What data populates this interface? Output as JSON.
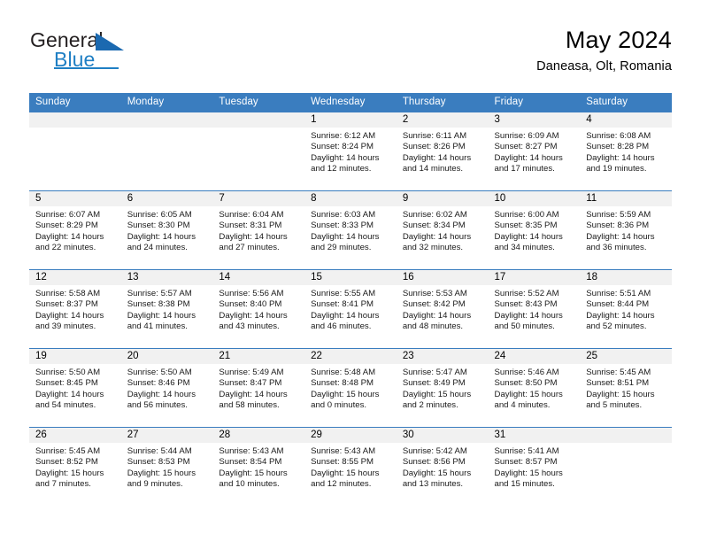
{
  "brand": {
    "name_part1": "General",
    "name_part2": "Blue",
    "logo_icon": "triangle-logo"
  },
  "header": {
    "title": "May 2024",
    "location": "Daneasa, Olt, Romania"
  },
  "colors": {
    "header_blue": "#3a7dbf",
    "brand_blue": "#1f7fc4",
    "daynum_band": "#f1f1f1",
    "text": "#000000"
  },
  "calendar": {
    "weekday_headers": [
      "Sunday",
      "Monday",
      "Tuesday",
      "Wednesday",
      "Thursday",
      "Friday",
      "Saturday"
    ],
    "labels": {
      "sunrise": "Sunrise:",
      "sunset": "Sunset:",
      "daylight": "Daylight:"
    },
    "weeks": [
      [
        {
          "day": "",
          "empty": true
        },
        {
          "day": "",
          "empty": true
        },
        {
          "day": "",
          "empty": true
        },
        {
          "day": "1",
          "sunrise": "Sunrise: 6:12 AM",
          "sunset": "Sunset: 8:24 PM",
          "daylight1": "Daylight: 14 hours",
          "daylight2": "and 12 minutes."
        },
        {
          "day": "2",
          "sunrise": "Sunrise: 6:11 AM",
          "sunset": "Sunset: 8:26 PM",
          "daylight1": "Daylight: 14 hours",
          "daylight2": "and 14 minutes."
        },
        {
          "day": "3",
          "sunrise": "Sunrise: 6:09 AM",
          "sunset": "Sunset: 8:27 PM",
          "daylight1": "Daylight: 14 hours",
          "daylight2": "and 17 minutes."
        },
        {
          "day": "4",
          "sunrise": "Sunrise: 6:08 AM",
          "sunset": "Sunset: 8:28 PM",
          "daylight1": "Daylight: 14 hours",
          "daylight2": "and 19 minutes."
        }
      ],
      [
        {
          "day": "5",
          "sunrise": "Sunrise: 6:07 AM",
          "sunset": "Sunset: 8:29 PM",
          "daylight1": "Daylight: 14 hours",
          "daylight2": "and 22 minutes."
        },
        {
          "day": "6",
          "sunrise": "Sunrise: 6:05 AM",
          "sunset": "Sunset: 8:30 PM",
          "daylight1": "Daylight: 14 hours",
          "daylight2": "and 24 minutes."
        },
        {
          "day": "7",
          "sunrise": "Sunrise: 6:04 AM",
          "sunset": "Sunset: 8:31 PM",
          "daylight1": "Daylight: 14 hours",
          "daylight2": "and 27 minutes."
        },
        {
          "day": "8",
          "sunrise": "Sunrise: 6:03 AM",
          "sunset": "Sunset: 8:33 PM",
          "daylight1": "Daylight: 14 hours",
          "daylight2": "and 29 minutes."
        },
        {
          "day": "9",
          "sunrise": "Sunrise: 6:02 AM",
          "sunset": "Sunset: 8:34 PM",
          "daylight1": "Daylight: 14 hours",
          "daylight2": "and 32 minutes."
        },
        {
          "day": "10",
          "sunrise": "Sunrise: 6:00 AM",
          "sunset": "Sunset: 8:35 PM",
          "daylight1": "Daylight: 14 hours",
          "daylight2": "and 34 minutes."
        },
        {
          "day": "11",
          "sunrise": "Sunrise: 5:59 AM",
          "sunset": "Sunset: 8:36 PM",
          "daylight1": "Daylight: 14 hours",
          "daylight2": "and 36 minutes."
        }
      ],
      [
        {
          "day": "12",
          "sunrise": "Sunrise: 5:58 AM",
          "sunset": "Sunset: 8:37 PM",
          "daylight1": "Daylight: 14 hours",
          "daylight2": "and 39 minutes."
        },
        {
          "day": "13",
          "sunrise": "Sunrise: 5:57 AM",
          "sunset": "Sunset: 8:38 PM",
          "daylight1": "Daylight: 14 hours",
          "daylight2": "and 41 minutes."
        },
        {
          "day": "14",
          "sunrise": "Sunrise: 5:56 AM",
          "sunset": "Sunset: 8:40 PM",
          "daylight1": "Daylight: 14 hours",
          "daylight2": "and 43 minutes."
        },
        {
          "day": "15",
          "sunrise": "Sunrise: 5:55 AM",
          "sunset": "Sunset: 8:41 PM",
          "daylight1": "Daylight: 14 hours",
          "daylight2": "and 46 minutes."
        },
        {
          "day": "16",
          "sunrise": "Sunrise: 5:53 AM",
          "sunset": "Sunset: 8:42 PM",
          "daylight1": "Daylight: 14 hours",
          "daylight2": "and 48 minutes."
        },
        {
          "day": "17",
          "sunrise": "Sunrise: 5:52 AM",
          "sunset": "Sunset: 8:43 PM",
          "daylight1": "Daylight: 14 hours",
          "daylight2": "and 50 minutes."
        },
        {
          "day": "18",
          "sunrise": "Sunrise: 5:51 AM",
          "sunset": "Sunset: 8:44 PM",
          "daylight1": "Daylight: 14 hours",
          "daylight2": "and 52 minutes."
        }
      ],
      [
        {
          "day": "19",
          "sunrise": "Sunrise: 5:50 AM",
          "sunset": "Sunset: 8:45 PM",
          "daylight1": "Daylight: 14 hours",
          "daylight2": "and 54 minutes."
        },
        {
          "day": "20",
          "sunrise": "Sunrise: 5:50 AM",
          "sunset": "Sunset: 8:46 PM",
          "daylight1": "Daylight: 14 hours",
          "daylight2": "and 56 minutes."
        },
        {
          "day": "21",
          "sunrise": "Sunrise: 5:49 AM",
          "sunset": "Sunset: 8:47 PM",
          "daylight1": "Daylight: 14 hours",
          "daylight2": "and 58 minutes."
        },
        {
          "day": "22",
          "sunrise": "Sunrise: 5:48 AM",
          "sunset": "Sunset: 8:48 PM",
          "daylight1": "Daylight: 15 hours",
          "daylight2": "and 0 minutes."
        },
        {
          "day": "23",
          "sunrise": "Sunrise: 5:47 AM",
          "sunset": "Sunset: 8:49 PM",
          "daylight1": "Daylight: 15 hours",
          "daylight2": "and 2 minutes."
        },
        {
          "day": "24",
          "sunrise": "Sunrise: 5:46 AM",
          "sunset": "Sunset: 8:50 PM",
          "daylight1": "Daylight: 15 hours",
          "daylight2": "and 4 minutes."
        },
        {
          "day": "25",
          "sunrise": "Sunrise: 5:45 AM",
          "sunset": "Sunset: 8:51 PM",
          "daylight1": "Daylight: 15 hours",
          "daylight2": "and 5 minutes."
        }
      ],
      [
        {
          "day": "26",
          "sunrise": "Sunrise: 5:45 AM",
          "sunset": "Sunset: 8:52 PM",
          "daylight1": "Daylight: 15 hours",
          "daylight2": "and 7 minutes."
        },
        {
          "day": "27",
          "sunrise": "Sunrise: 5:44 AM",
          "sunset": "Sunset: 8:53 PM",
          "daylight1": "Daylight: 15 hours",
          "daylight2": "and 9 minutes."
        },
        {
          "day": "28",
          "sunrise": "Sunrise: 5:43 AM",
          "sunset": "Sunset: 8:54 PM",
          "daylight1": "Daylight: 15 hours",
          "daylight2": "and 10 minutes."
        },
        {
          "day": "29",
          "sunrise": "Sunrise: 5:43 AM",
          "sunset": "Sunset: 8:55 PM",
          "daylight1": "Daylight: 15 hours",
          "daylight2": "and 12 minutes."
        },
        {
          "day": "30",
          "sunrise": "Sunrise: 5:42 AM",
          "sunset": "Sunset: 8:56 PM",
          "daylight1": "Daylight: 15 hours",
          "daylight2": "and 13 minutes."
        },
        {
          "day": "31",
          "sunrise": "Sunrise: 5:41 AM",
          "sunset": "Sunset: 8:57 PM",
          "daylight1": "Daylight: 15 hours",
          "daylight2": "and 15 minutes."
        },
        {
          "day": "",
          "empty": true
        }
      ]
    ]
  }
}
